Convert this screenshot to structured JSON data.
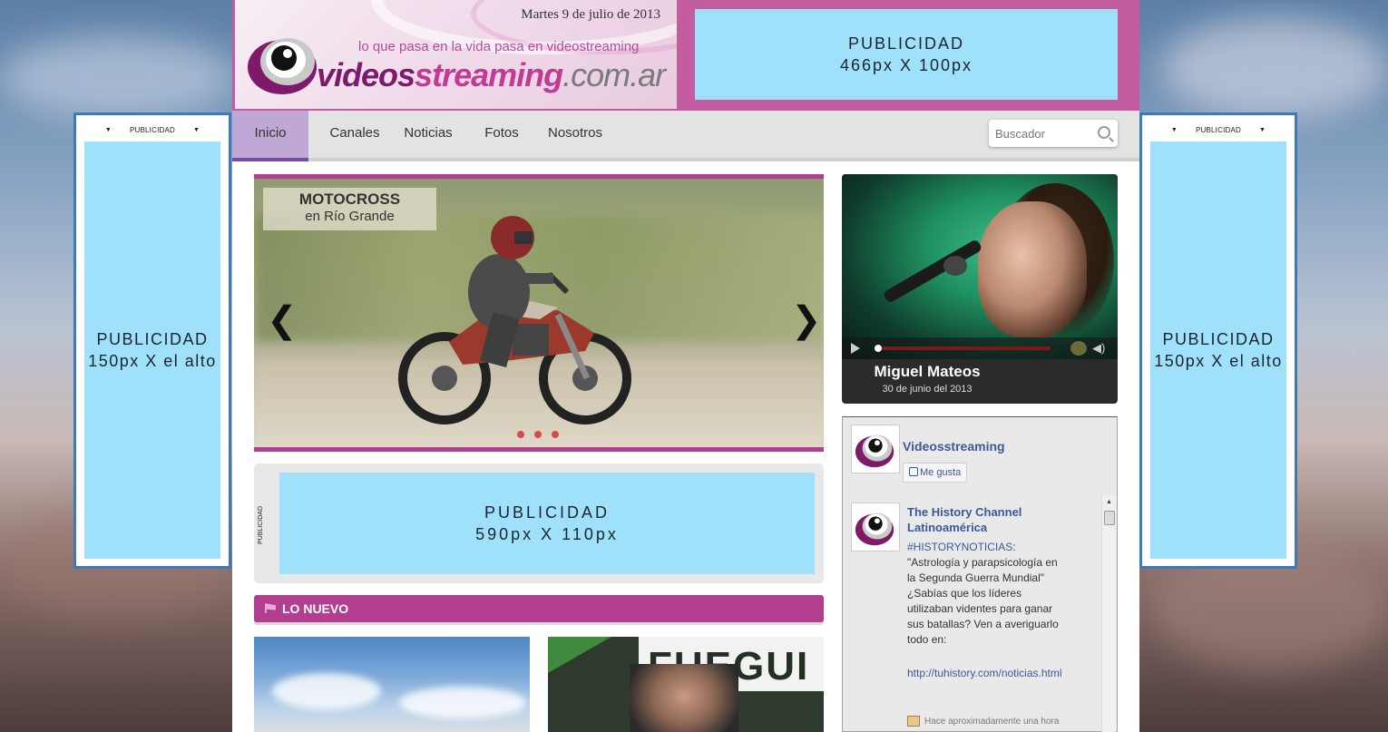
{
  "header": {
    "date": "Martes 9 de julio de 2013",
    "tagline": "lo que pasa en la vida pasa en videostreaming",
    "logo_word_1": "videos",
    "logo_word_2": "streaming",
    "logo_word_3": ".com.ar"
  },
  "top_ad": {
    "line1": "PUBLICIDAD",
    "line2": "466px X 100px"
  },
  "side_ads": {
    "label": "PUBLICIDAD",
    "line1": "PUBLICIDAD",
    "line2": "150px X el alto"
  },
  "nav": {
    "items": [
      {
        "label": "Inicio"
      },
      {
        "label": "Canales"
      },
      {
        "label": "Noticias"
      },
      {
        "label": "Fotos"
      },
      {
        "label": "Nosotros"
      }
    ],
    "active_index": 0,
    "search_placeholder": "Buscador"
  },
  "slider": {
    "caption_title": "MOTOCROSS",
    "caption_subtitle": "en Río Grande",
    "prev_glyph": "❮",
    "next_glyph": "❯",
    "slide_count": 3
  },
  "middle_ad": {
    "side_label": "PUBLICIDAD",
    "line1": "PUBLICIDAD",
    "line2": "590px X 110px"
  },
  "lo_nuevo": {
    "title": "LO NUEVO"
  },
  "featured_video": {
    "title": "Miguel Mateos",
    "date": "30 de junio del 2013"
  },
  "facebook": {
    "page_name": "Videosstreaming",
    "like_label": "Me gusta",
    "post": {
      "author": "The History Channel Latinoamérica",
      "hashtag": "#HISTORYNOTICIAS",
      "text": ": \"Astrología y parapsicología en la Segunda Guerra Mundial\" ¿Sabías que los líderes utilizaban videntes para ganar sus batallas? Ven a averiguarlo todo en:",
      "link": "http://tuhistory.com/noticias.html",
      "time": "Hace aproximadamente una hora"
    }
  },
  "colors": {
    "brand_magenta": "#b23e8f",
    "header_pink": "#c45da0",
    "ad_blue": "#9fe1fb",
    "nav_active": "#c0a8d6",
    "side_border": "#3f7ab8",
    "fb_link": "#3b5998"
  }
}
